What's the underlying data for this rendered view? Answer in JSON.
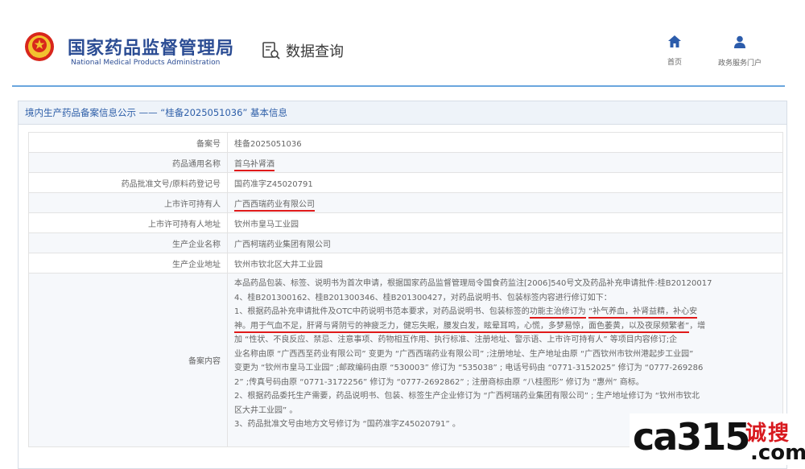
{
  "header": {
    "logo_cn": "国家药品监督管理局",
    "logo_en": "National Medical Products Administration",
    "query_label": "数据查询",
    "nav": [
      {
        "icon": "home-icon",
        "label": "首页"
      },
      {
        "icon": "user-icon",
        "label": "政务服务门户"
      }
    ]
  },
  "panel": {
    "title": "境内生产药品备案信息公示 —— “桂备2025051036” 基本信息"
  },
  "rows": [
    {
      "key": "备案号",
      "value": "桂备2025051036"
    },
    {
      "key": "药品通用名称",
      "value": "首乌补肾酒"
    },
    {
      "key": "药品批准文号/原料药登记号",
      "value": "国药准字Z45020791"
    },
    {
      "key": "上市许可持有人",
      "value": "广西西瑞药业有限公司"
    },
    {
      "key": "上市许可持有人地址",
      "value": "钦州市皇马工业园"
    },
    {
      "key": "生产企业名称",
      "value": "广西柯瑞药业集团有限公司"
    },
    {
      "key": "生产企业地址",
      "value": "钦州市钦北区大井工业园"
    }
  ],
  "content": {
    "key": "备案内容",
    "lines": [
      "本品药品包装、标签、说明书为首次申请，根据国家药品监督管理局令国食药监注[2006]540号文及药品补充申请批件:桂B20120017",
      "4、桂B201300162、桂B201300346、桂B201300427，对药品说明书、包装标签内容进行修订如下：",
      "1、根据药品补充申请批件及OTC中药说明书范本要求，对药品说明书、包装标签的",
      "功能主治修订为",
      "“补气养血，补肾益精，补心安",
      "神。用于气血不足，肝肾与肾阴亏的神疲乏力，健忘失眠，腰发白发，眩晕耳鸣，心慌，多梦易惊，面色萎黄，以及夜尿频繁者”",
      "，增",
      "加 “性状、不良反应、禁忌、注意事项、药物相互作用、执行标准、注册地址、警示语、上市许可持有人” 等项目内容修订;企",
      "业名称由原 “广西西至药业有限公司” 变更为 “广西西瑞药业有限公司” ;注册地址、生产地址由原 “广西钦州市钦州港起步工业园”",
      "变更为 “钦州市皇马工业园” ;邮政编码由原 “530003” 修订为 “535038” ; 电话号码由 “0771-3152025” 修订为 “0777-269286",
      "2” ;传真号码由原 “0771-3172256” 修订为 “0777-2692862” ; 注册商标由原 “八桂图形” 修订为 “惠州” 商标。",
      "2、根据药品委托生产需要，药品说明书、包装、标签生产企业修订为 “广西柯瑞药业集团有限公司” ; 生产地址修订为 “钦州市钦北",
      "区大井工业园” 。",
      "3、药品批准文号由地方文号修订为 “国药准字Z45020791” 。"
    ]
  },
  "watermark": {
    "main": "ca315",
    "cn": "诚搜",
    "com": ".com"
  },
  "colors": {
    "brand_blue": "#2c4d94",
    "header_line": "#6aa6de",
    "underline_red": "#e01a1a",
    "watermark_red": "#d8191e"
  }
}
